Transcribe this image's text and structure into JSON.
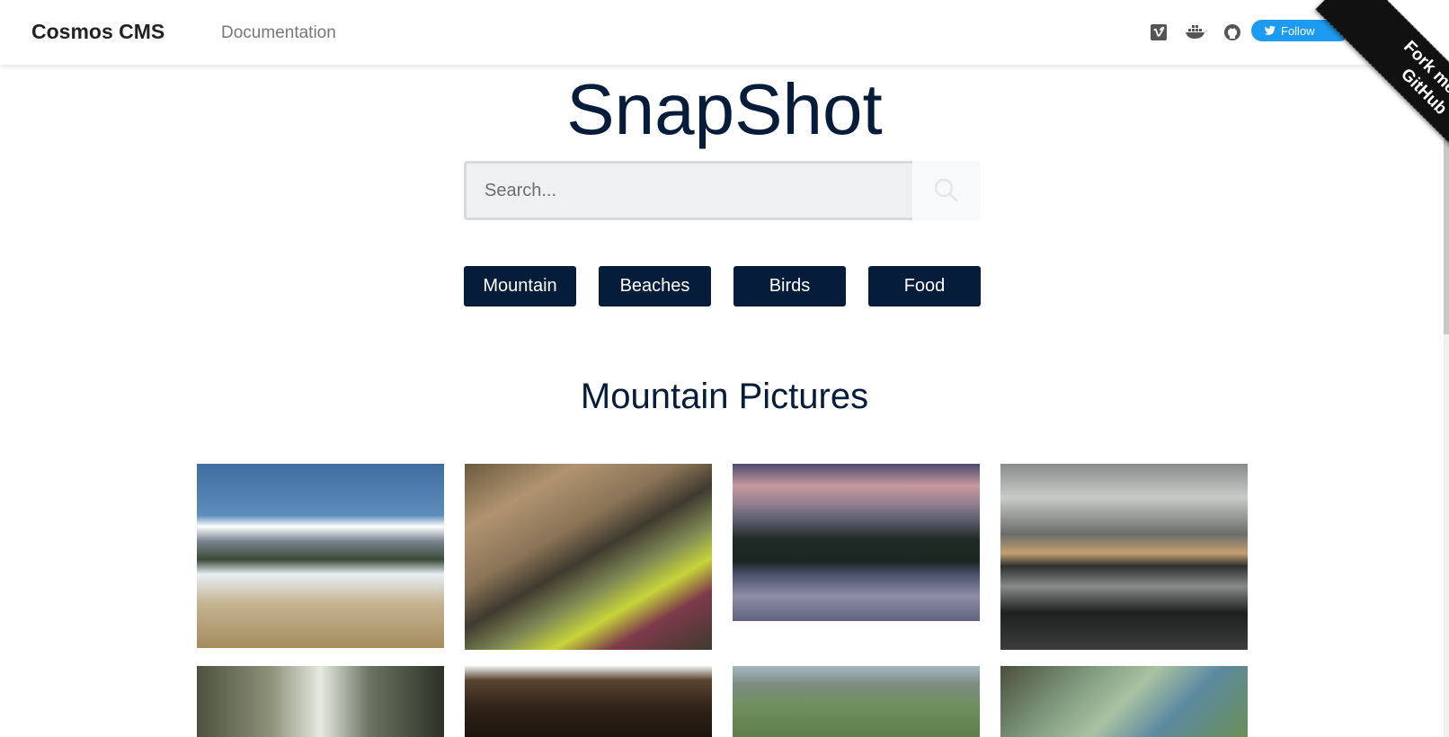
{
  "navbar": {
    "brand": "Cosmos CMS",
    "links": [
      "Documentation"
    ],
    "icons": [
      "vimeo-icon",
      "docker-icon",
      "github-icon"
    ],
    "follow_label": "Follow"
  },
  "ribbon": {
    "line1": "Fork me on",
    "line2": "GitHub"
  },
  "hero": {
    "title": "SnapShot"
  },
  "search": {
    "placeholder": "Search..."
  },
  "categories": [
    "Mountain",
    "Beaches",
    "Birds",
    "Food"
  ],
  "gallery": {
    "heading": "Mountain Pictures",
    "photos": [
      "snowy-mountain-meadow",
      "people-examining-rock-cave",
      "lake-at-dusk-with-forest",
      "alpine-village-lake-reflection",
      "forest-trees",
      "wooden-shed",
      "valley-farmland",
      "cliff-overlooking-valley"
    ]
  },
  "colors": {
    "primary": "#051d3a",
    "twitter": "#1d9bf0",
    "ribbon": "#111111",
    "search_bg": "#eef0f2"
  }
}
